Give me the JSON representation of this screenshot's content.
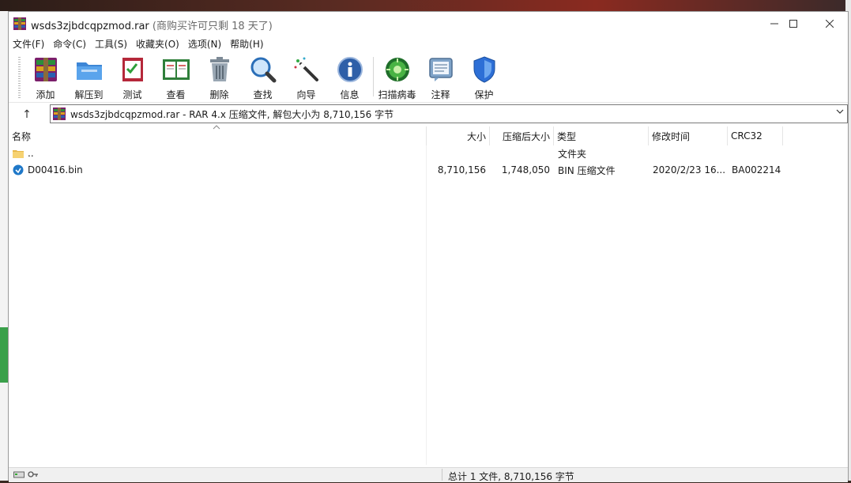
{
  "window": {
    "title": "wsds3zjbdcqpzmod.rar",
    "title_suffix": "(商购买许可只剩 18 天了)"
  },
  "menu": [
    "文件(F)",
    "命令(C)",
    "工具(S)",
    "收藏夹(O)",
    "选项(N)",
    "帮助(H)"
  ],
  "toolbar": [
    {
      "label": "添加",
      "icon": "add-archive-icon"
    },
    {
      "label": "解压到",
      "icon": "extract-to-icon"
    },
    {
      "label": "测试",
      "icon": "test-icon"
    },
    {
      "label": "查看",
      "icon": "view-icon"
    },
    {
      "label": "删除",
      "icon": "delete-icon"
    },
    {
      "label": "查找",
      "icon": "find-icon"
    },
    {
      "label": "向导",
      "icon": "wizard-icon"
    },
    {
      "label": "信息",
      "icon": "info-icon"
    },
    {
      "label": "扫描病毒",
      "icon": "virus-scan-icon"
    },
    {
      "label": "注释",
      "icon": "comment-icon"
    },
    {
      "label": "保护",
      "icon": "protect-icon"
    }
  ],
  "address": {
    "up_glyph": "↑",
    "text": "wsds3zjbdcqpzmod.rar - RAR 4.x 压缩文件, 解包大小为 8,710,156 字节"
  },
  "columns": {
    "name": "名称",
    "size": "大小",
    "packed": "压缩后大小",
    "type": "类型",
    "modified": "修改时间",
    "crc": "CRC32"
  },
  "rows": [
    {
      "name": "..",
      "size": "",
      "packed": "",
      "type": "文件夹",
      "modified": "",
      "crc": "",
      "icon": "folder-icon"
    },
    {
      "name": "D00416.bin",
      "size": "8,710,156",
      "packed": "1,748,050",
      "type": "BIN 压缩文件",
      "modified": "2020/2/23 16...",
      "crc": "BA002214",
      "icon": "bin-file-icon"
    }
  ],
  "status": {
    "summary": "总计 1 文件, 8,710,156 字节"
  },
  "colors": {
    "border": "#9a9a9a",
    "status_bg": "#f0f0f0"
  }
}
